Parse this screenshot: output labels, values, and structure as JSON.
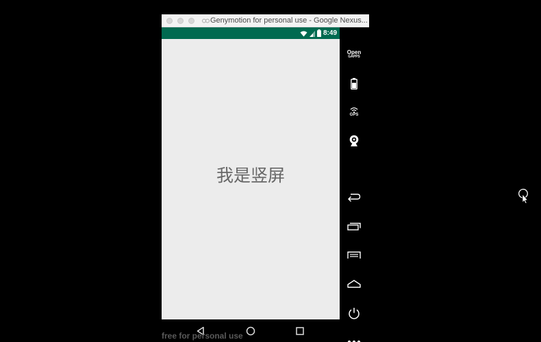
{
  "window": {
    "title": "Genymotion for personal use - Google Nexus..."
  },
  "statusbar": {
    "time": "8:49",
    "icons": [
      "wifi-icon",
      "signal-icon",
      "battery-icon"
    ]
  },
  "screen": {
    "center_text": "我是竖屏",
    "background": "#ececec",
    "statusbar_color": "#006a50"
  },
  "navbar": {
    "buttons": [
      "back-icon",
      "home-icon",
      "recents-icon"
    ]
  },
  "watermark": {
    "text": "free for personal use"
  },
  "sidebar": {
    "opengapps_line1": "Open",
    "opengapps_line2": "GAPPS",
    "gps_label": "GPS",
    "buttons": [
      "open-gapps-icon",
      "battery-icon",
      "gps-icon",
      "camera-icon",
      "back-icon",
      "recents-icon",
      "menu-icon",
      "home-icon",
      "power-icon",
      "more-icon"
    ]
  }
}
